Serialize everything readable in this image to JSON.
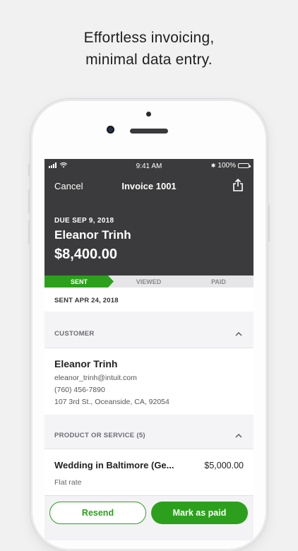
{
  "headline": {
    "line1": "Effortless invoicing,",
    "line2": "minimal data entry."
  },
  "status_bar": {
    "time": "9:41 AM",
    "battery": "100%",
    "bluetooth": "✱"
  },
  "nav": {
    "cancel": "Cancel",
    "title": "Invoice 1001",
    "share_icon": "share-icon"
  },
  "invoice": {
    "due": "DUE SEP 9, 2018",
    "customer_name": "Eleanor Trinh",
    "amount": "$8,400.00"
  },
  "progress": {
    "sent": "SENT",
    "viewed": "VIEWED",
    "paid": "PAID",
    "active": "sent"
  },
  "sent_date": "SENT APR 24, 2018",
  "customer_section": {
    "label": "CUSTOMER",
    "name": "Eleanor Trinh",
    "email": "eleanor_trinh@intuit.com",
    "phone": "(760) 456-7890",
    "address": "107 3rd St., Oceanside, CA, 92054"
  },
  "product_section": {
    "label": "PRODUCT OR SERVICE (5)",
    "items": [
      {
        "name": "Wedding in Baltimore (Ge...",
        "amount": "$5,000.00",
        "detail": "Flat rate"
      }
    ]
  },
  "actions": {
    "resend": "Resend",
    "mark_paid": "Mark as paid"
  },
  "colors": {
    "accent": "#2ca01c",
    "header_bg": "#3b3b3d"
  }
}
